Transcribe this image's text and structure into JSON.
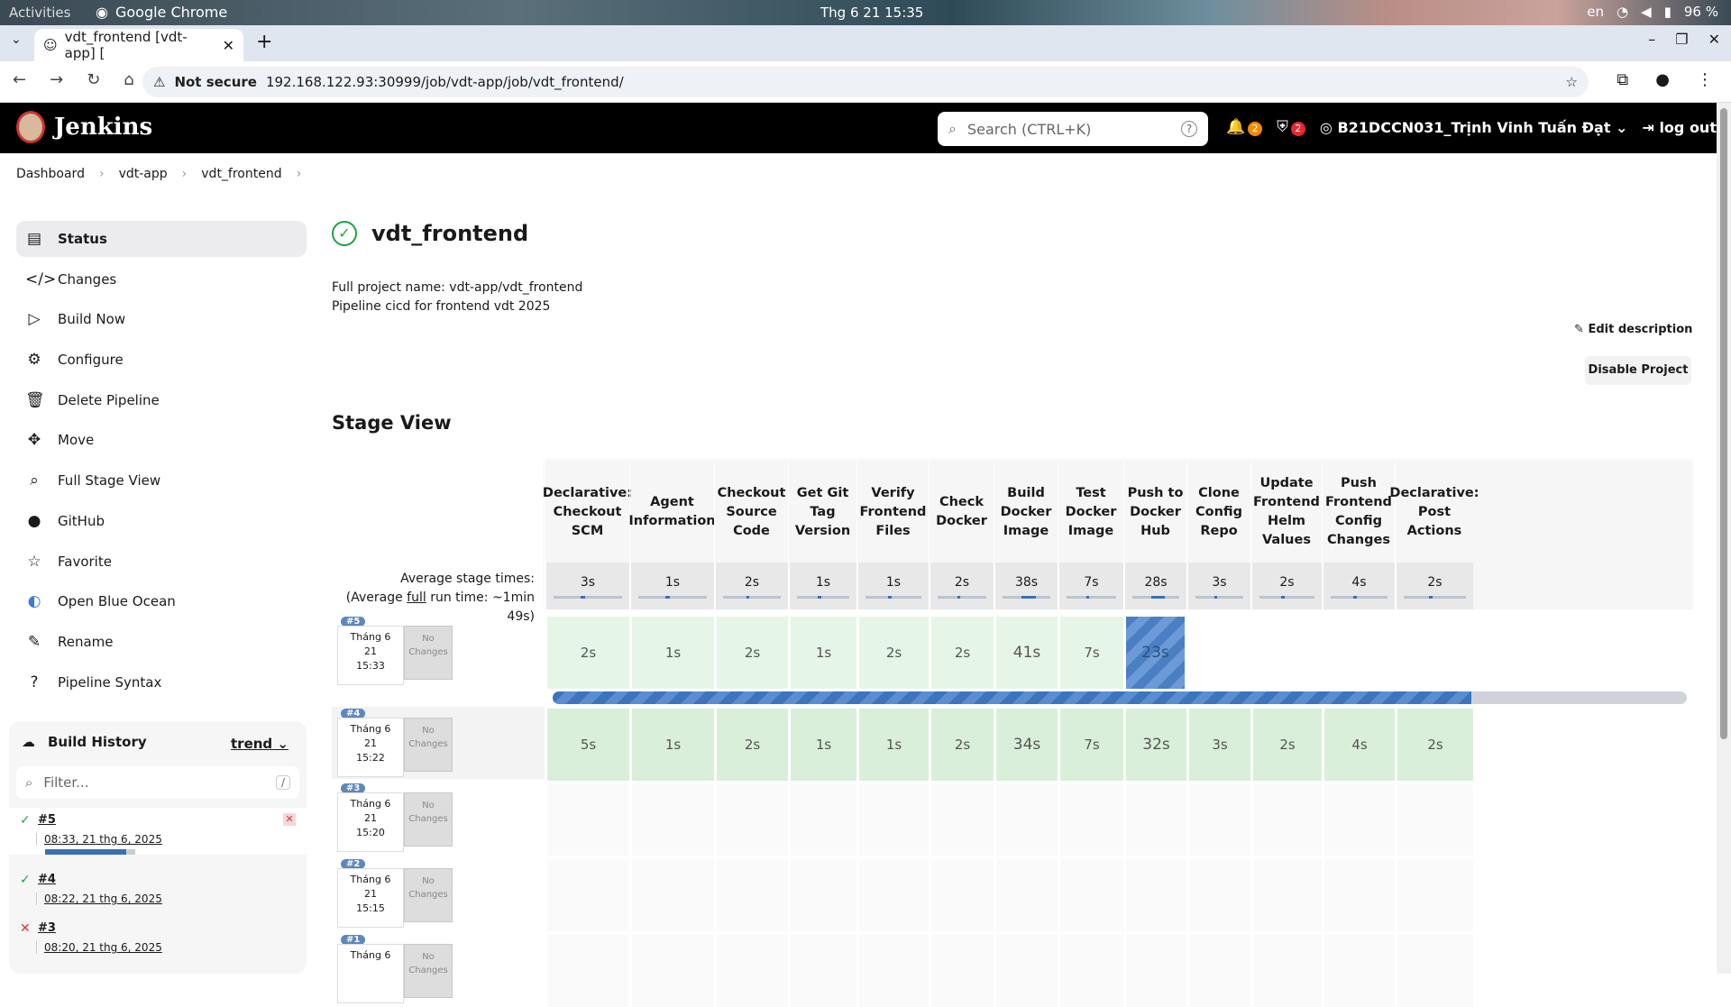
{
  "os": {
    "activities": "Activities",
    "app": "Google Chrome",
    "clock": "Thg 6 21  15:35",
    "lang": "en",
    "battery": "96 %"
  },
  "browser": {
    "tab_title": "vdt_frontend [vdt-app] [",
    "security": "Not secure",
    "url": "192.168.122.93:30999/job/vdt-app/job/vdt_frontend/"
  },
  "header": {
    "brand": "Jenkins",
    "search_placeholder": "Search (CTRL+K)",
    "notif_count": "2",
    "security_count": "2",
    "user": "B21DCCN031_Trịnh Vinh Tuấn Đạt",
    "logout": "log out"
  },
  "breadcrumb": [
    "Dashboard",
    "vdt-app",
    "vdt_frontend"
  ],
  "sidebar": {
    "items": [
      {
        "label": "Status",
        "icon": "document-icon"
      },
      {
        "label": "Changes",
        "icon": "code-icon"
      },
      {
        "label": "Build Now",
        "icon": "play-icon"
      },
      {
        "label": "Configure",
        "icon": "gear-icon"
      },
      {
        "label": "Delete Pipeline",
        "icon": "trash-icon"
      },
      {
        "label": "Move",
        "icon": "move-icon"
      },
      {
        "label": "Full Stage View",
        "icon": "search-icon"
      },
      {
        "label": "GitHub",
        "icon": "github-icon"
      },
      {
        "label": "Favorite",
        "icon": "star-icon"
      },
      {
        "label": "Open Blue Ocean",
        "icon": "blue-ocean-icon"
      },
      {
        "label": "Rename",
        "icon": "pencil-icon"
      },
      {
        "label": "Pipeline Syntax",
        "icon": "question-icon"
      }
    ]
  },
  "build_history": {
    "title": "Build History",
    "trend": "trend",
    "filter_placeholder": "Filter...",
    "filter_key": "/",
    "builds": [
      {
        "num": "#5",
        "date": "08:33, 21 thg 6, 2025",
        "status": "running"
      },
      {
        "num": "#4",
        "date": "08:22, 21 thg 6, 2025",
        "status": "success"
      },
      {
        "num": "#3",
        "date": "08:20, 21 thg 6, 2025",
        "status": "failed"
      }
    ]
  },
  "project": {
    "title": "vdt_frontend",
    "full_name": "Full project name: vdt-app/vdt_frontend",
    "description": "Pipeline cicd for frontend  vdt 2025",
    "edit_description": "Edit description",
    "disable": "Disable Project"
  },
  "stage_view": {
    "title": "Stage View",
    "avg_label": "Average stage times:",
    "avg_run_prefix": "(Average ",
    "avg_run_link": "full",
    "avg_run_suffix": " run time: ~1min 49s)",
    "stages": [
      "Declarative: Checkout SCM",
      "Agent Information",
      "Checkout Source Code",
      "Get Git Tag Version",
      "Verify Frontend Files",
      "Check Docker",
      "Build Docker Image",
      "Test Docker Image",
      "Push to Docker Hub",
      "Clone Config Repo",
      "Update Frontend Helm Values",
      "Push Frontend Config Changes",
      "Declarative: Post Actions"
    ],
    "avg_times": [
      "3s",
      "1s",
      "2s",
      "1s",
      "1s",
      "2s",
      "38s",
      "7s",
      "28s",
      "3s",
      "2s",
      "4s",
      "2s"
    ],
    "no_changes": "No Changes",
    "runs": [
      {
        "badge": "#5",
        "date": "Tháng 6",
        "day": "21",
        "time": "15:33",
        "times": [
          "2s",
          "1s",
          "2s",
          "1s",
          "2s",
          "2s",
          "41s",
          "7s",
          "23s",
          "",
          "",
          "",
          ""
        ],
        "progress": 0.81
      },
      {
        "badge": "#4",
        "date": "Tháng 6",
        "day": "21",
        "time": "15:22",
        "times": [
          "5s",
          "1s",
          "2s",
          "1s",
          "1s",
          "2s",
          "34s",
          "7s",
          "32s",
          "3s",
          "2s",
          "4s",
          "2s"
        ]
      },
      {
        "badge": "#3",
        "date": "Tháng 6",
        "day": "21",
        "time": "15:20",
        "times": []
      },
      {
        "badge": "#2",
        "date": "Tháng 6",
        "day": "21",
        "time": "15:15",
        "times": []
      },
      {
        "badge": "#1",
        "date": "Tháng 6",
        "day": "",
        "time": "",
        "times": []
      }
    ]
  }
}
